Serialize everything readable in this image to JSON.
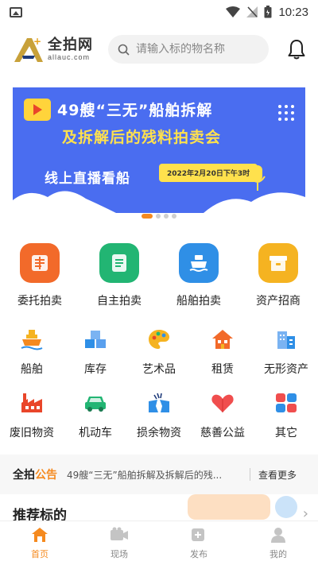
{
  "status_bar": {
    "time": "10:23"
  },
  "header": {
    "logo_name": "全拍网",
    "logo_domain": "allauc.com",
    "search_placeholder": "请输入标的物名称"
  },
  "banner": {
    "title_line1": "49艘“三无”船舶拆解",
    "title_line2": "及拆解后的残料拍卖会",
    "subtitle": "线上直播看船",
    "date": "2022年2月20日下午3时",
    "page_count": 4,
    "active_page": 0
  },
  "main_categories": [
    {
      "label": "委托拍卖",
      "icon": "delegate-icon",
      "color": "#f26a2a"
    },
    {
      "label": "自主拍卖",
      "icon": "document-icon",
      "color": "#22b573"
    },
    {
      "label": "船舶拍卖",
      "icon": "ship-icon",
      "color": "#2f8fe6"
    },
    {
      "label": "资产招商",
      "icon": "box-icon",
      "color": "#f5b321"
    }
  ],
  "sub_categories": [
    {
      "label": "船舶",
      "icon": "ship-small-icon"
    },
    {
      "label": "库存",
      "icon": "inventory-icon"
    },
    {
      "label": "艺术品",
      "icon": "palette-icon"
    },
    {
      "label": "租赁",
      "icon": "house-icon"
    },
    {
      "label": "无形资产",
      "icon": "building-icon"
    },
    {
      "label": "废旧物资",
      "icon": "factory-icon"
    },
    {
      "label": "机动车",
      "icon": "car-icon"
    },
    {
      "label": "损余物资",
      "icon": "broken-icon"
    },
    {
      "label": "慈善公益",
      "icon": "charity-icon"
    },
    {
      "label": "其它",
      "icon": "grid-icon"
    }
  ],
  "notice": {
    "brand": "全拍",
    "tag": "公告",
    "text": "49艘“三无”船舶拆解及拆解后的残...",
    "more": "查看更多"
  },
  "recommend_title": "推荐标的",
  "tabbar": [
    {
      "label": "首页",
      "icon": "home-icon",
      "active": true
    },
    {
      "label": "现场",
      "icon": "camera-icon",
      "active": false
    },
    {
      "label": "发布",
      "icon": "publish-icon",
      "active": false
    },
    {
      "label": "我的",
      "icon": "user-icon",
      "active": false
    }
  ],
  "colors": {
    "accent": "#f58a1f",
    "banner": "#4a6df0",
    "yellow": "#ffe14d"
  }
}
